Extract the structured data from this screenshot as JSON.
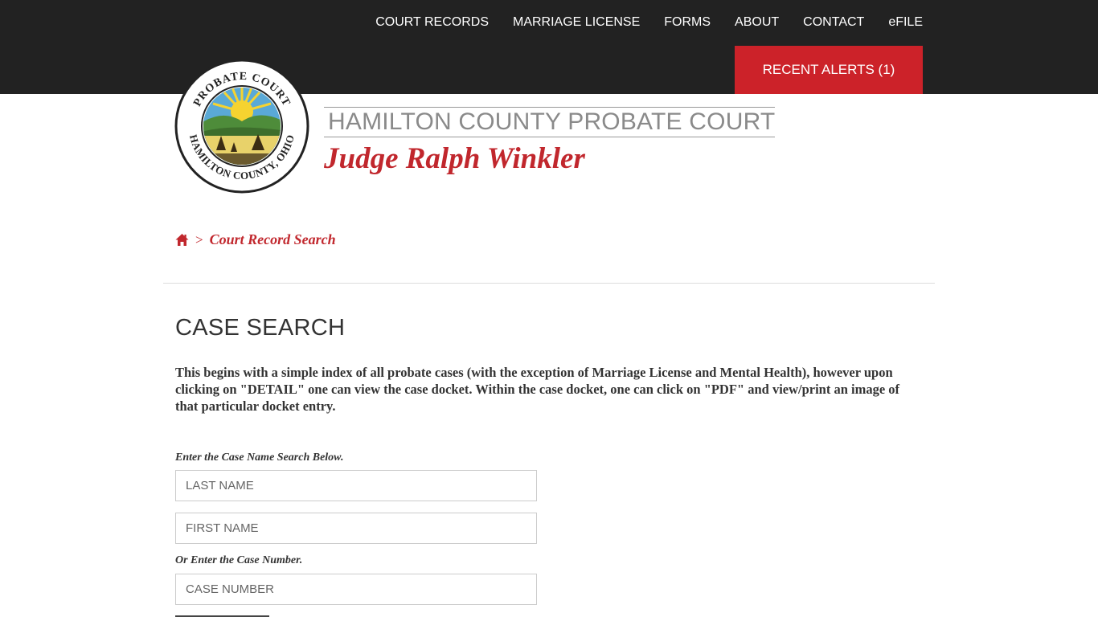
{
  "nav": {
    "items": [
      {
        "label": "COURT RECORDS"
      },
      {
        "label": "MARRIAGE LICENSE"
      },
      {
        "label": "FORMS"
      },
      {
        "label": "ABOUT"
      },
      {
        "label": "CONTACT"
      },
      {
        "label": "eFILE"
      }
    ],
    "alerts_label": "RECENT ALERTS (1)"
  },
  "header": {
    "seal_text_top": "PROBATE COURT",
    "seal_text_bottom": "HAMILTON COUNTY, OHIO",
    "court_name": "HAMILTON COUNTY PROBATE COURT",
    "judge_name": "Judge Ralph Winkler"
  },
  "breadcrumb": {
    "home_icon": "home-icon",
    "separator": ">",
    "current": "Court Record Search"
  },
  "main": {
    "title": "CASE SEARCH",
    "intro": "This begins with a simple index of all probate cases (with the exception of Marriage License and Mental Health), however upon clicking on \"DETAIL\" one can view the case docket. Within the case docket, one can click on \"PDF\" and view/print an image of that particular docket entry.",
    "name_search_label": "Enter the Case Name Search Below.",
    "last_name_placeholder": "LAST NAME",
    "first_name_placeholder": "FIRST NAME",
    "case_number_label": "Or Enter the Case Number.",
    "case_number_placeholder": "CASE NUMBER"
  },
  "colors": {
    "topbar": "#222222",
    "accent_red": "#cc2229",
    "title_gray": "#8a8a8a"
  }
}
